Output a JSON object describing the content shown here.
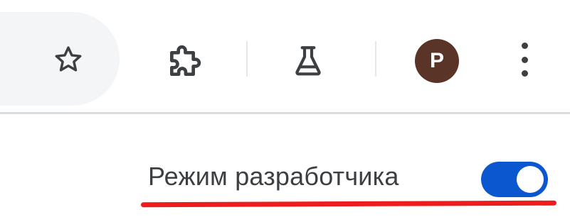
{
  "toolbar": {
    "icons": {
      "bookmark": "star-outline-icon",
      "extensions": "puzzle-piece-icon",
      "labs": "flask-icon",
      "menu": "three-dots-vertical-icon"
    },
    "profile": {
      "initial": "P",
      "avatar_color": "#5b3428"
    }
  },
  "extensions_page": {
    "developer_mode": {
      "label": "Режим разработчика",
      "enabled": true,
      "toggle_color": "#0b57d0"
    },
    "highlight_color": "#ee1c1c"
  }
}
